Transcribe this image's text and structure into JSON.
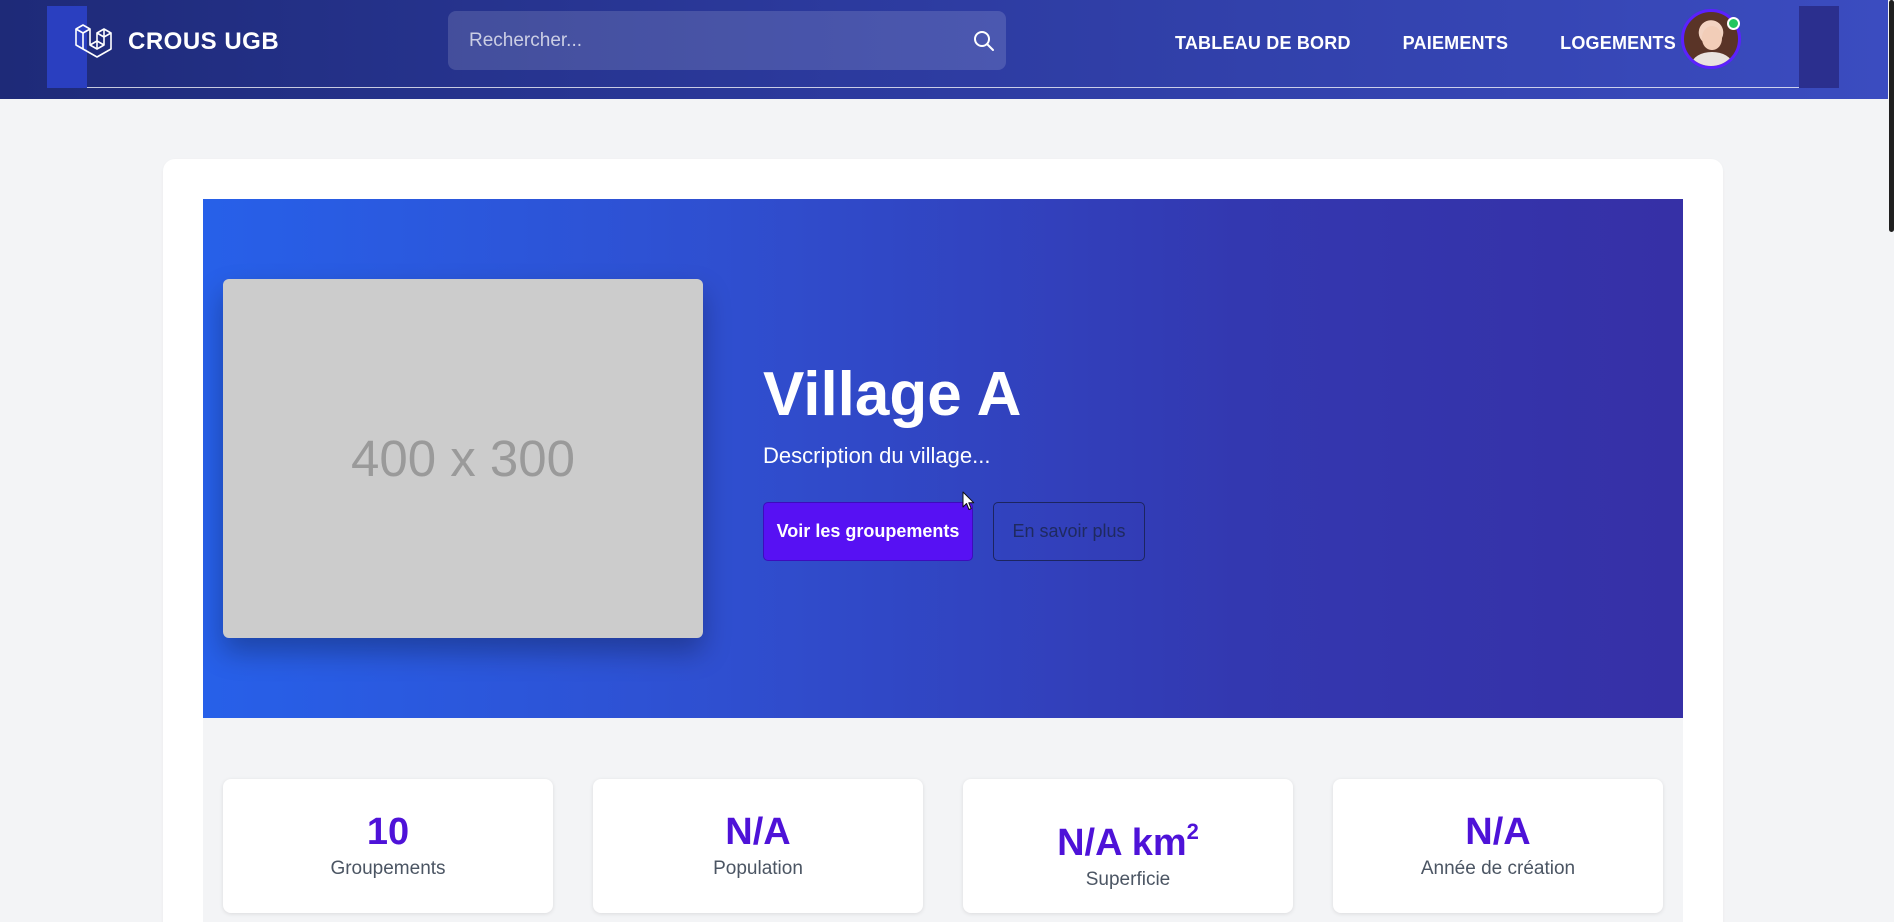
{
  "navbar": {
    "brand": "CROUS UGB",
    "search_placeholder": "Rechercher...",
    "links": [
      "TABLEAU DE BORD",
      "PAIEMENTS",
      "LOGEMENTS"
    ],
    "logo_icon": "laravel-logo-icon",
    "search_icon": "search-icon"
  },
  "hero": {
    "placeholder_text": "400 x 300",
    "title": "Village A",
    "description": "Description du village...",
    "primary_button": "Voir les groupements",
    "secondary_button": "En savoir plus"
  },
  "stats": [
    {
      "value": "10",
      "label": "Groupements"
    },
    {
      "value": "N/A",
      "label": "Population"
    },
    {
      "value": "N/A km",
      "sup": "2",
      "label": "Superficie"
    },
    {
      "value": "N/A",
      "label": "Année de création"
    }
  ],
  "colors": {
    "accent": "#5711f3",
    "stat_value": "#4e12d8",
    "online": "#22c55e"
  }
}
